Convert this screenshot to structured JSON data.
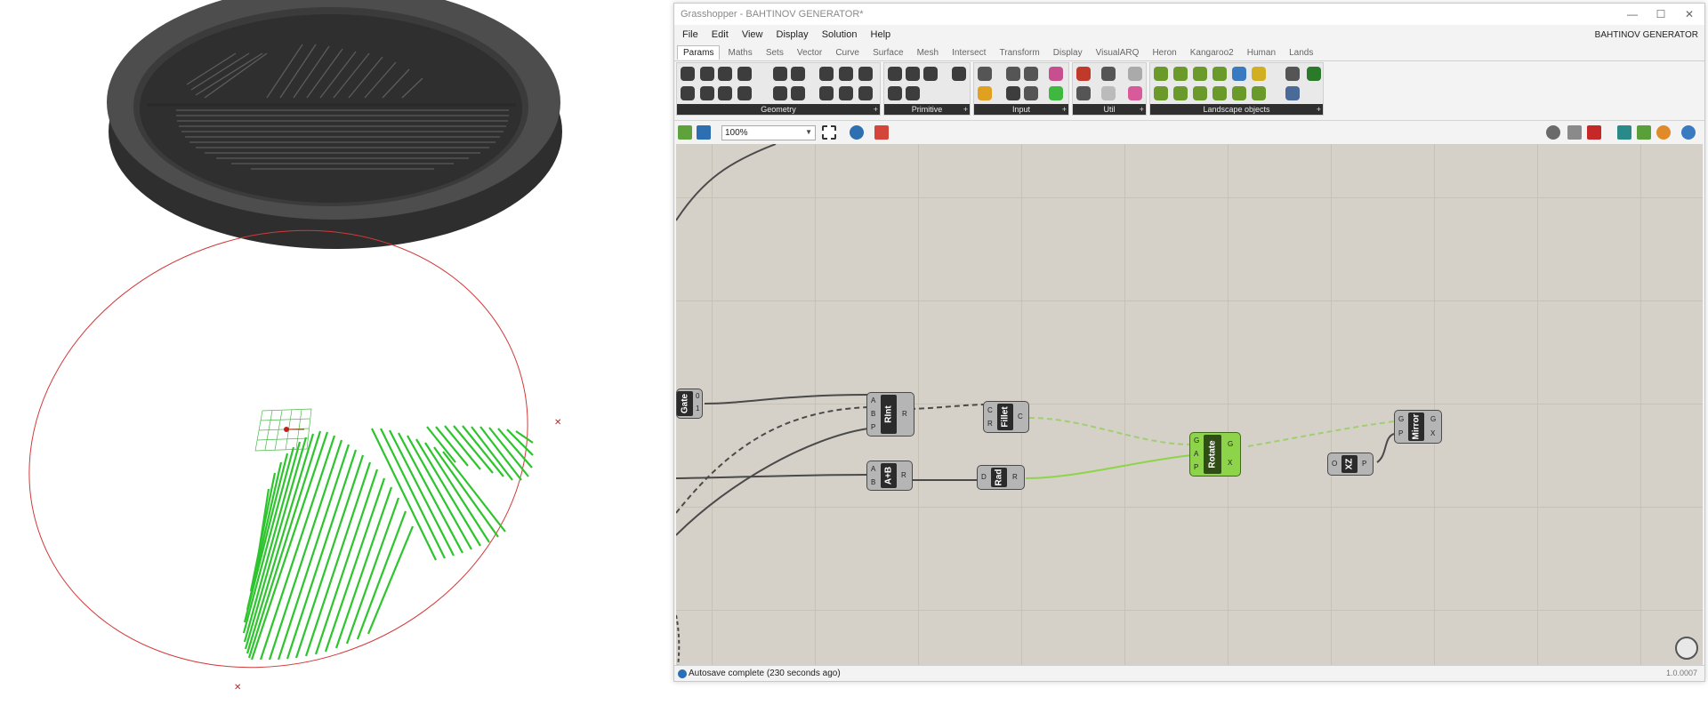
{
  "window": {
    "title": "Grasshopper - BAHTINOV GENERATOR*",
    "doc_name": "BAHTINOV GENERATOR",
    "controls": {
      "minimize": "—",
      "maximize": "☐",
      "close": "✕"
    }
  },
  "menu": [
    "File",
    "Edit",
    "View",
    "Display",
    "Solution",
    "Help"
  ],
  "tabs": [
    "Params",
    "Maths",
    "Sets",
    "Vector",
    "Curve",
    "Surface",
    "Mesh",
    "Intersect",
    "Transform",
    "Display",
    "VisualARQ",
    "Heron",
    "Kangaroo2",
    "Human",
    "Lands"
  ],
  "active_tab": "Params",
  "ribbon_panels": [
    {
      "label": "Geometry"
    },
    {
      "label": "Primitive"
    },
    {
      "label": "Input"
    },
    {
      "label": "Util"
    },
    {
      "label": "Landscape objects"
    }
  ],
  "canvas_toolbar": {
    "zoom": "100%"
  },
  "components": {
    "gate": {
      "name": "Gate",
      "outputs": [
        "0",
        "1"
      ]
    },
    "rint": {
      "name": "RInt",
      "inputs": [
        "A",
        "B",
        "P"
      ],
      "outputs": [
        "R"
      ]
    },
    "fillet": {
      "name": "Fillet",
      "inputs": [
        "C",
        "R"
      ],
      "outputs": [
        "C"
      ]
    },
    "addition": {
      "name": "A+B",
      "inputs": [
        "A",
        "B"
      ],
      "outputs": [
        "R"
      ]
    },
    "radians": {
      "name": "Rad",
      "inputs": [
        "D"
      ],
      "outputs": [
        "R"
      ]
    },
    "rotate": {
      "name": "Rotate",
      "inputs": [
        "G",
        "A",
        "P"
      ],
      "outputs": [
        "G",
        "X"
      ]
    },
    "xz": {
      "name": "XZ",
      "inputs": [
        "O"
      ],
      "outputs": [
        "P"
      ]
    },
    "mirror": {
      "name": "Mirror",
      "inputs": [
        "G",
        "P"
      ],
      "outputs": [
        "G",
        "X"
      ]
    }
  },
  "status": {
    "message": "Autosave complete (230 seconds ago)",
    "version": "1.0.0007"
  },
  "colors": {
    "canvas": "#d5d1c8",
    "preview_green": "#2ec42e",
    "curve_red": "#d23a3a",
    "solid_dark": "#3a3a3a",
    "rotate_green": "#8ed44a"
  }
}
